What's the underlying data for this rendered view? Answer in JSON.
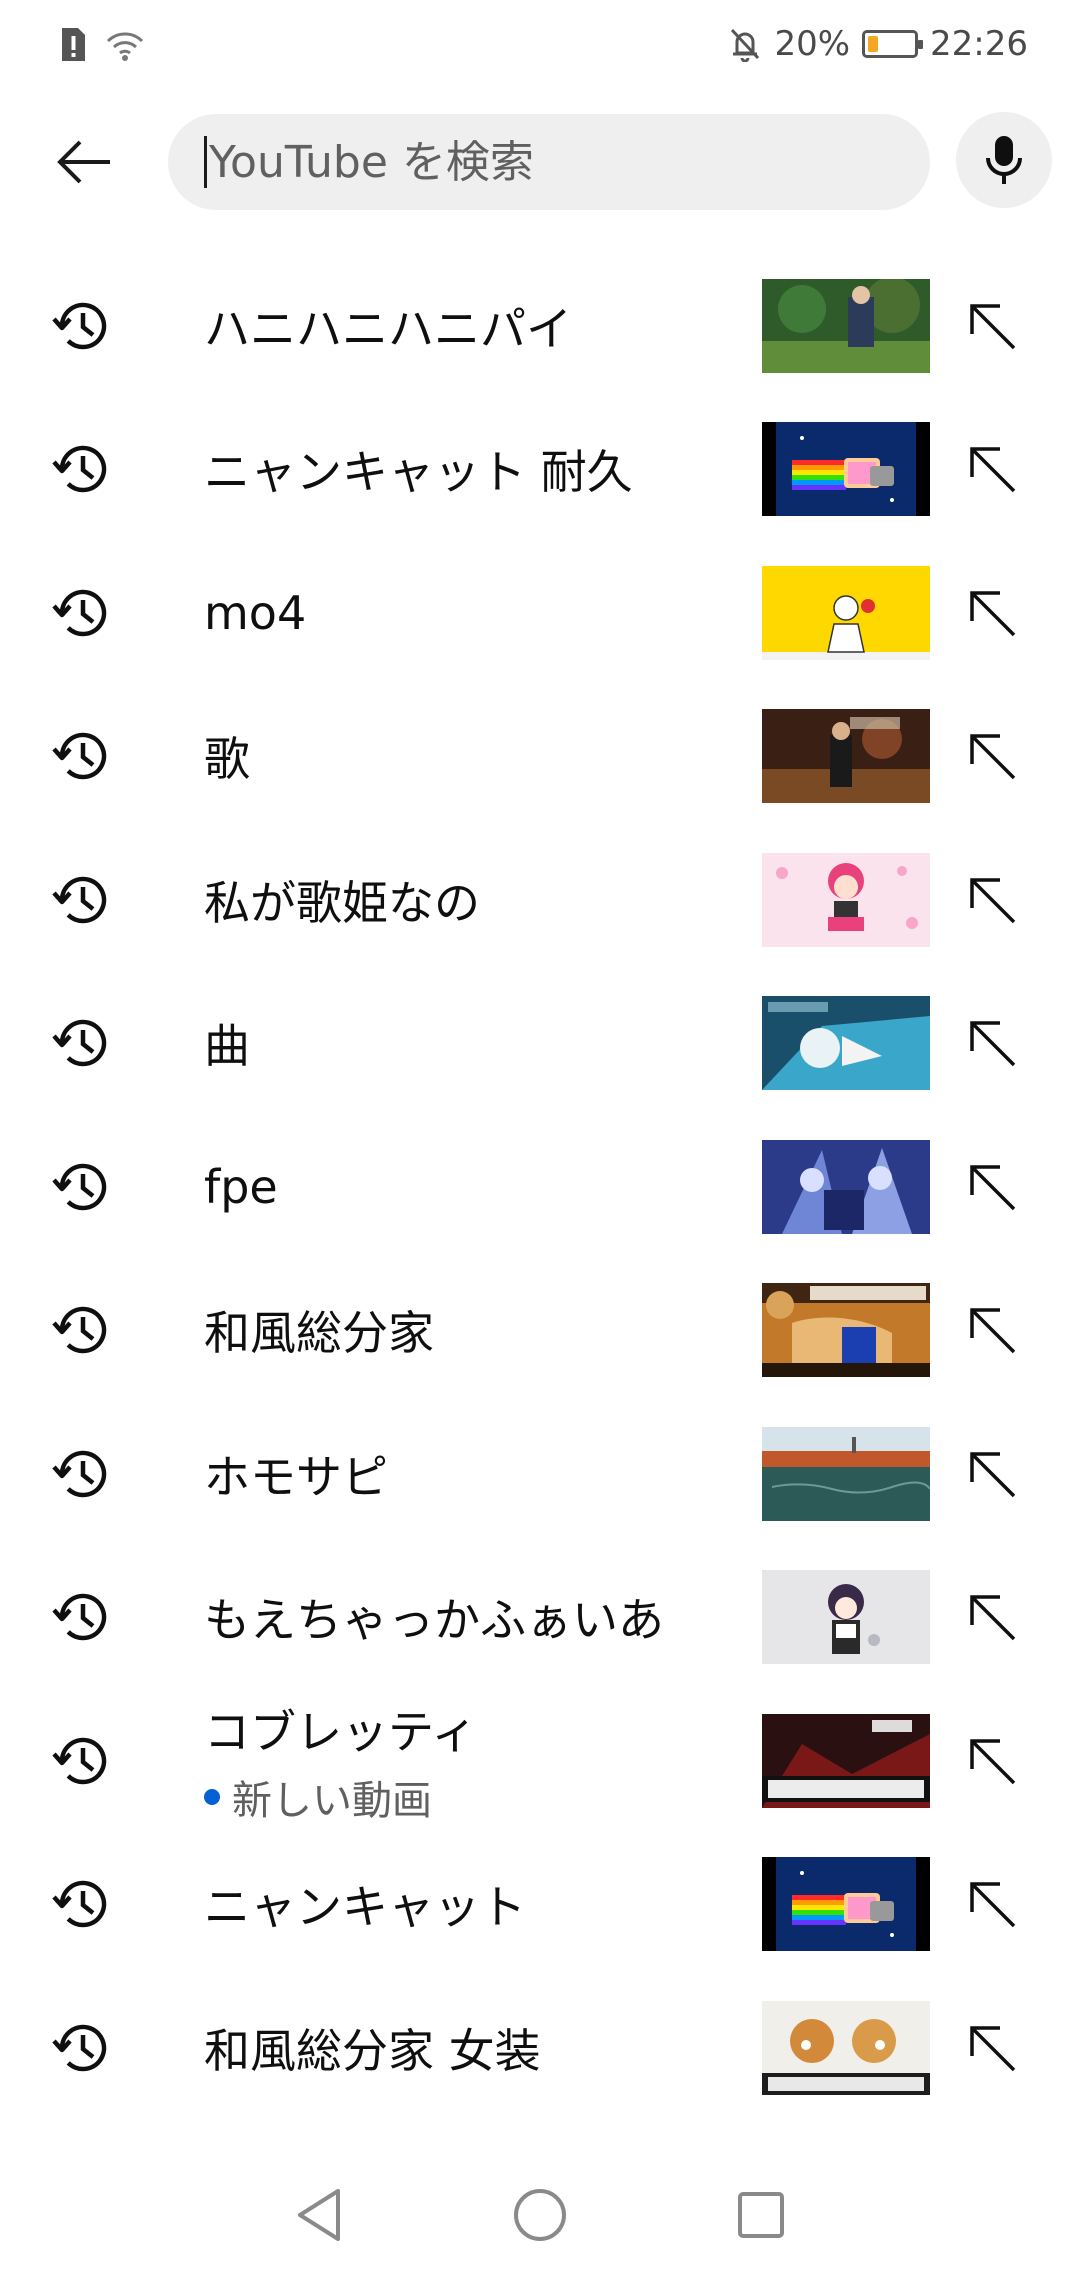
{
  "status_bar": {
    "battery_percent": "20%",
    "battery_level": 0.2,
    "time": "22:26",
    "colors": {
      "battery_fill": "#f5a623"
    }
  },
  "search": {
    "placeholder": "YouTube を検索",
    "value": ""
  },
  "history": [
    {
      "label": "ハニハニハニパイ",
      "thumb": "park"
    },
    {
      "label": "ニャンキャット 耐久",
      "thumb": "nyancat"
    },
    {
      "label": "mo4",
      "thumb": "yellow"
    },
    {
      "label": "歌",
      "thumb": "dark-red"
    },
    {
      "label": "私が歌姫なの",
      "thumb": "pink"
    },
    {
      "label": "曲",
      "thumb": "teal"
    },
    {
      "label": "fpe",
      "thumb": "blue-anime"
    },
    {
      "label": "和風総分家",
      "thumb": "travel"
    },
    {
      "label": "ホモサピ",
      "thumb": "sea"
    },
    {
      "label": "もえちゃっかふぁいあ",
      "thumb": "grey-anime"
    },
    {
      "label": "コブレッティ",
      "sublabel": "新しい動画",
      "thumb": "red-game"
    },
    {
      "label": "ニャンキャット",
      "thumb": "nyancat"
    },
    {
      "label": "和風総分家 女装",
      "thumb": "dogs"
    }
  ],
  "colors": {
    "new_video_dot": "#065fd4",
    "search_box_bg": "#efefef"
  }
}
